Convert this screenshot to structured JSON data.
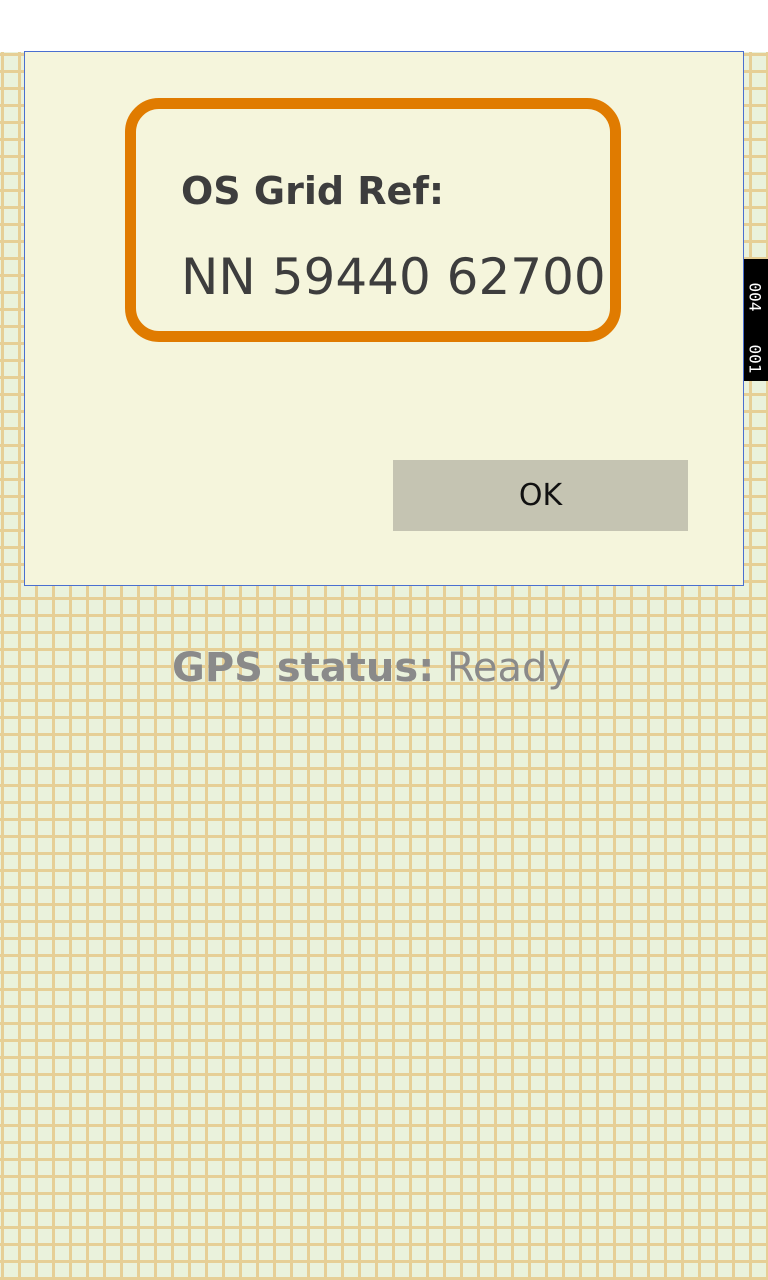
{
  "dialog": {
    "ref_label": "OS Grid Ref:",
    "ref_value": "NN 59440 62700",
    "ok_label": "OK"
  },
  "gps": {
    "label": "GPS status:",
    "value": "Ready"
  },
  "side_tab": {
    "text_top": "004",
    "text_bottom": "001"
  },
  "colors": {
    "accent": "#e07b00",
    "dialog_background": "#f5f5dc",
    "button_background": "#c5c4b2",
    "grid_line": "#e6cf96",
    "grid_background": "#eaf2dc"
  }
}
